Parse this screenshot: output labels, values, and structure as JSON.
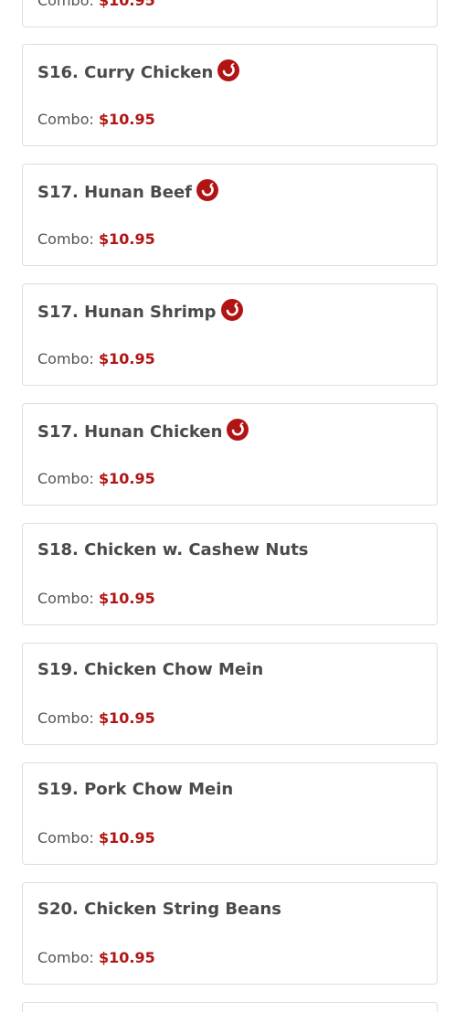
{
  "combo_label": "Combo:",
  "accent_color": "#b21414",
  "items": [
    {
      "name": "",
      "price": "$10.95",
      "spicy": false
    },
    {
      "name": "S16. Curry Chicken",
      "price": "$10.95",
      "spicy": true
    },
    {
      "name": "S17. Hunan Beef",
      "price": "$10.95",
      "spicy": true
    },
    {
      "name": "S17. Hunan Shrimp",
      "price": "$10.95",
      "spicy": true
    },
    {
      "name": "S17. Hunan Chicken",
      "price": "$10.95",
      "spicy": true
    },
    {
      "name": "S18. Chicken w. Cashew Nuts",
      "price": "$10.95",
      "spicy": false
    },
    {
      "name": "S19. Chicken Chow Mein",
      "price": "$10.95",
      "spicy": false
    },
    {
      "name": "S19. Pork Chow Mein",
      "price": "$10.95",
      "spicy": false
    },
    {
      "name": "S20. Chicken String Beans",
      "price": "$10.95",
      "spicy": false
    },
    {
      "name": "",
      "price": "",
      "spicy": false
    }
  ],
  "spicy_icon": "chili-pepper-icon"
}
